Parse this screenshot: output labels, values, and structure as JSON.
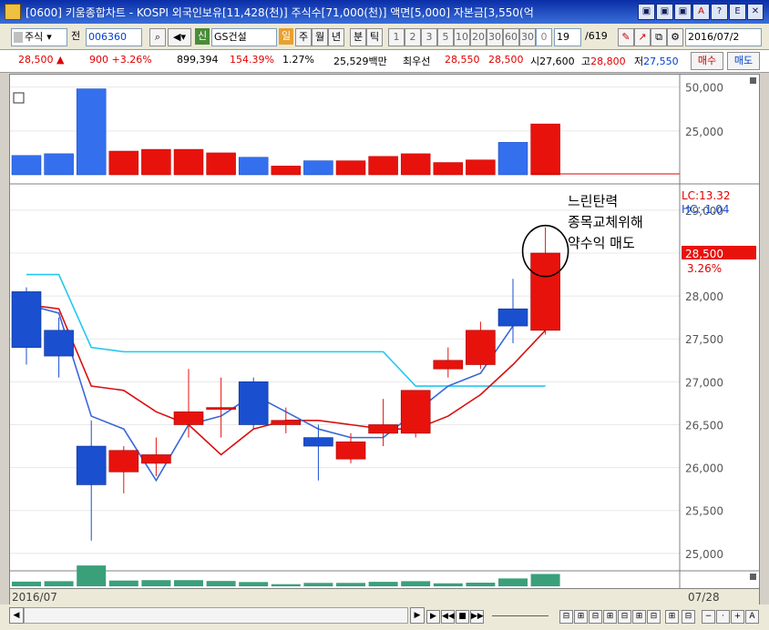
{
  "window": {
    "title": "[0600] 키움종합차트 - KOSPI 외국인보유[11,428(천)] 주식수[71,000(천)] 액면[5,000] 자본금[3,550(억",
    "buttons": [
      "▣",
      "▣",
      "▣",
      "A",
      "?",
      "E",
      "▢",
      "✕"
    ]
  },
  "toolbar": {
    "market": "주식",
    "prev": "전",
    "code": "006360",
    "credit_badge": "신",
    "name": "GS건설",
    "day": "일",
    "periods": [
      "주",
      "월",
      "년",
      "분",
      "틱"
    ],
    "nums": [
      "1",
      "2",
      "3",
      "5",
      "10",
      "20",
      "30",
      "60",
      "30",
      "0"
    ],
    "count": "19",
    "total": "/619",
    "date": "2016/07/2"
  },
  "info": {
    "price": "28,500",
    "change": "900",
    "rate": "+3.26%",
    "volume": "899,394",
    "vol_ratio": "154.39%",
    "turnover": "1.27%",
    "amount": "25,529백만",
    "best_label": "최우선",
    "best_ask": "28,550",
    "best_bid": "28,500",
    "open_label": "시",
    "open": "27,600",
    "high_label": "고",
    "high": "28,800",
    "low_label": "저",
    "low": "27,550",
    "buy": "매수",
    "sell": "매도"
  },
  "chart": {
    "annotation": [
      "느린탄력",
      "종목교체위해",
      "약수익 매도"
    ],
    "lc_label": "LC:13.32",
    "hc_label": "HC:-1.04",
    "price_tag": "28,500",
    "rate_tag": "3.26%",
    "vol_ticks": [
      "50,000",
      "25,000"
    ],
    "price_ticks": [
      "29,000",
      "28,500",
      "28,000",
      "27,500",
      "27,000",
      "26,500",
      "26,000",
      "25,500",
      "25,000"
    ],
    "start_date": "2016/07",
    "end_date": "07/28"
  },
  "chart_data": {
    "type": "candlestick",
    "candles": [
      {
        "o": 28050,
        "h": 28100,
        "l": 27200,
        "c": 27400
      },
      {
        "o": 27600,
        "h": 27750,
        "l": 27050,
        "c": 27300
      },
      {
        "o": 26250,
        "h": 26550,
        "l": 25150,
        "c": 25800
      },
      {
        "o": 25950,
        "h": 26250,
        "l": 25700,
        "c": 26200
      },
      {
        "o": 26050,
        "h": 26350,
        "l": 25900,
        "c": 26150
      },
      {
        "o": 26500,
        "h": 27150,
        "l": 26350,
        "c": 26650
      },
      {
        "o": 26700,
        "h": 27050,
        "l": 26350,
        "c": 26700
      },
      {
        "o": 27000,
        "h": 27050,
        "l": 26450,
        "c": 26500
      },
      {
        "o": 26500,
        "h": 26700,
        "l": 26400,
        "c": 26550
      },
      {
        "o": 26350,
        "h": 26500,
        "l": 25850,
        "c": 26250
      },
      {
        "o": 26100,
        "h": 26400,
        "l": 26050,
        "c": 26300
      },
      {
        "o": 26400,
        "h": 26800,
        "l": 26250,
        "c": 26500
      },
      {
        "o": 26400,
        "h": 26900,
        "l": 26350,
        "c": 26900
      },
      {
        "o": 27150,
        "h": 27400,
        "l": 27050,
        "c": 27250
      },
      {
        "o": 27200,
        "h": 27700,
        "l": 27150,
        "c": 27600
      },
      {
        "o": 27850,
        "h": 28200,
        "l": 27450,
        "c": 27650
      },
      {
        "o": 27600,
        "h": 28800,
        "l": 27550,
        "c": 28500
      }
    ],
    "volumes": [
      11000,
      12000,
      49000,
      13500,
      14500,
      14500,
      12500,
      10000,
      5000,
      8000,
      8000,
      10500,
      12000,
      7000,
      8500,
      18500,
      29000
    ],
    "ma_red": [
      27900,
      27850,
      26950,
      26900,
      26650,
      26500,
      26150,
      26450,
      26550,
      26550,
      26500,
      26450,
      26450,
      26600,
      26850,
      27200,
      27600
    ],
    "ma_blue": [
      27900,
      27800,
      26600,
      26450,
      25850,
      26500,
      26600,
      26850,
      26650,
      26450,
      26350,
      26350,
      26650,
      26950,
      27100,
      27650,
      null
    ],
    "ma_cyan": [
      28250,
      28250,
      27400,
      27350,
      27350,
      27350,
      27350,
      27350,
      27350,
      27350,
      27350,
      27350,
      26950,
      26950,
      26950,
      26950,
      26950
    ],
    "y_price_range": [
      24850,
      29200
    ],
    "y_vol_range": [
      0,
      55000
    ]
  }
}
